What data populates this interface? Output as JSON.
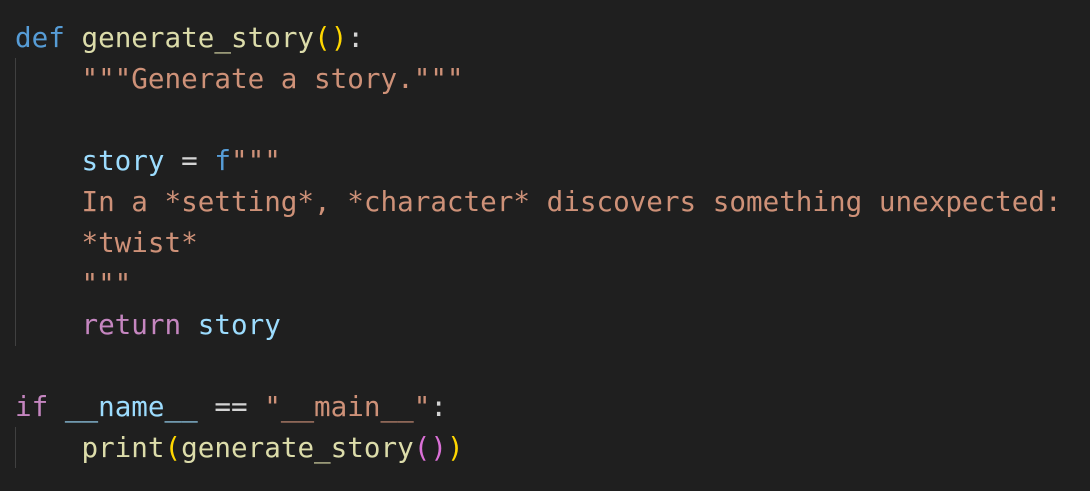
{
  "editor": {
    "lines": [
      {
        "tokens": [
          {
            "text": "def",
            "type": "kw"
          },
          {
            "text": " ",
            "type": "op"
          },
          {
            "text": "generate_story",
            "type": "fn"
          },
          {
            "text": "(",
            "type": "b1"
          },
          {
            "text": ")",
            "type": "b1"
          },
          {
            "text": ":",
            "type": "op"
          }
        ]
      },
      {
        "tokens": [
          {
            "text": "    ",
            "type": "op"
          },
          {
            "text": "\"\"\"Generate a story.\"\"\"",
            "type": "str"
          }
        ]
      },
      {
        "tokens": []
      },
      {
        "tokens": [
          {
            "text": "    ",
            "type": "op"
          },
          {
            "text": "story",
            "type": "var"
          },
          {
            "text": " = ",
            "type": "op"
          },
          {
            "text": "f",
            "type": "kw"
          },
          {
            "text": "\"\"\"",
            "type": "str"
          }
        ]
      },
      {
        "tokens": [
          {
            "text": "    ",
            "type": "op"
          },
          {
            "text": "In a *setting*, *character* discovers something unexpected:",
            "type": "str"
          }
        ]
      },
      {
        "tokens": [
          {
            "text": "    ",
            "type": "op"
          },
          {
            "text": "*twist*",
            "type": "str"
          }
        ]
      },
      {
        "tokens": [
          {
            "text": "    ",
            "type": "op"
          },
          {
            "text": "\"\"\"",
            "type": "str"
          }
        ]
      },
      {
        "tokens": [
          {
            "text": "    ",
            "type": "op"
          },
          {
            "text": "return",
            "type": "ctl"
          },
          {
            "text": " ",
            "type": "op"
          },
          {
            "text": "story",
            "type": "var"
          }
        ]
      },
      {
        "tokens": []
      },
      {
        "tokens": [
          {
            "text": "if",
            "type": "ctl"
          },
          {
            "text": " ",
            "type": "op"
          },
          {
            "text": "__name__",
            "type": "var"
          },
          {
            "text": " == ",
            "type": "op"
          },
          {
            "text": "\"__main__\"",
            "type": "str"
          },
          {
            "text": ":",
            "type": "op"
          }
        ]
      },
      {
        "tokens": [
          {
            "text": "    ",
            "type": "op"
          },
          {
            "text": "print",
            "type": "fn"
          },
          {
            "text": "(",
            "type": "b1"
          },
          {
            "text": "generate_story",
            "type": "fn"
          },
          {
            "text": "(",
            "type": "b2"
          },
          {
            "text": ")",
            "type": "b2"
          },
          {
            "text": ")",
            "type": "b1"
          }
        ]
      }
    ]
  },
  "colors": {
    "background": "#1f1f1f",
    "keyword": "#569cd6",
    "control": "#c586c0",
    "function": "#dcdcaa",
    "variable": "#9cdcfe",
    "string": "#ce9178",
    "bracket_level1": "#ffd700",
    "bracket_level2": "#da70d6",
    "indent_guide": "#404040"
  }
}
